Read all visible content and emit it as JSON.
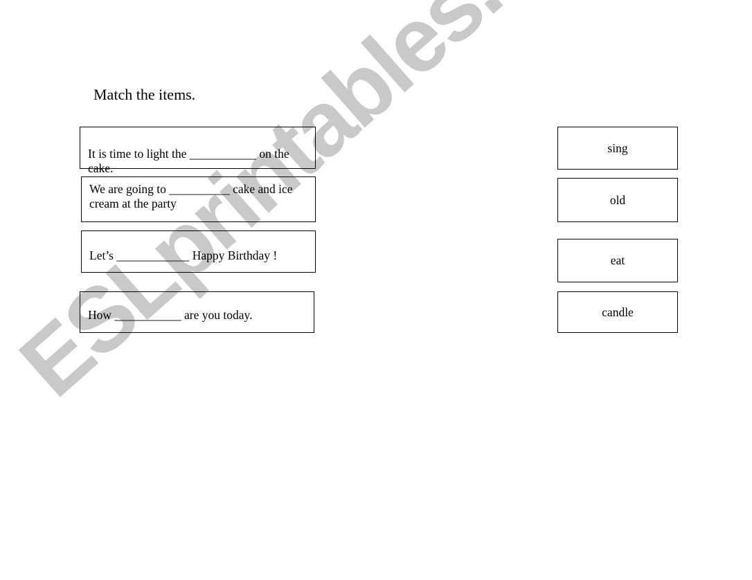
{
  "page": {
    "title": "Match the items.",
    "background_color": "#ffffff",
    "text_color": "#000000",
    "border_color": "#000000"
  },
  "watermark": {
    "text": "ESLprintables.com",
    "color": "#c9c9c9"
  },
  "exercise": {
    "prompts": [
      {
        "text": "It is time to light the ___________ on the cake."
      },
      {
        "text": "We are going to __________ cake and ice\ncream at the party"
      },
      {
        "text": "Let’s ____________ Happy Birthday !"
      },
      {
        "text": "How ___________ are you today."
      }
    ],
    "answers": [
      {
        "text": "sing"
      },
      {
        "text": "old"
      },
      {
        "text": "eat"
      },
      {
        "text": "candle"
      }
    ]
  }
}
